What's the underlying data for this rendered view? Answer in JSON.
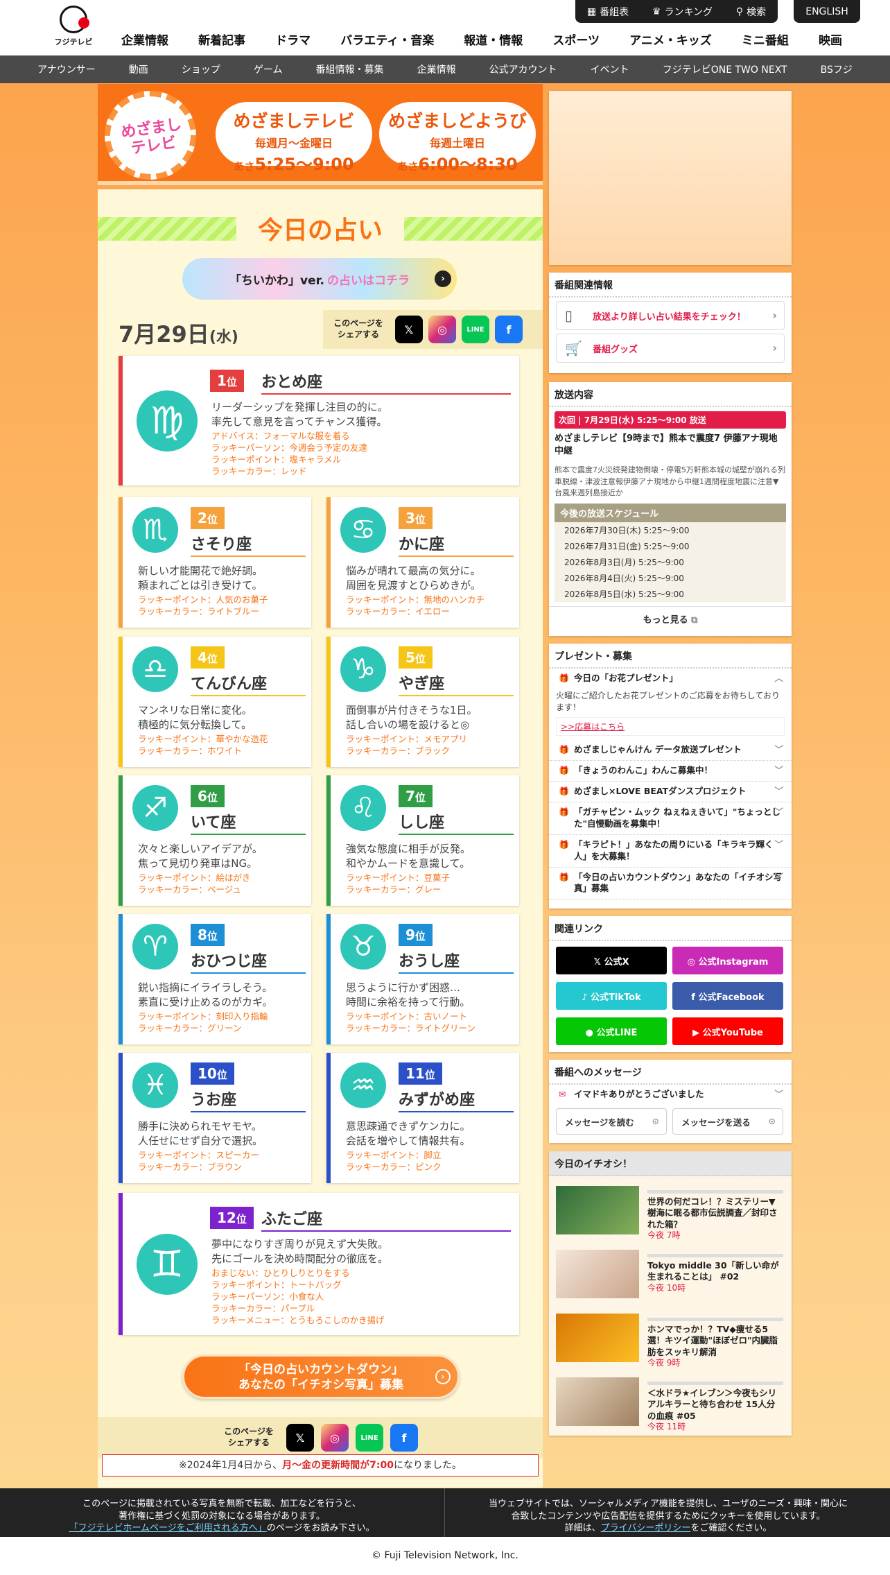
{
  "header": {
    "logo_text": "フジテレビ",
    "toolbar": [
      {
        "label": "番組表",
        "icon": "grid-icon"
      },
      {
        "label": "ランキング",
        "icon": "crown-icon"
      },
      {
        "label": "検索",
        "icon": "search-icon"
      }
    ],
    "english": "ENGLISH",
    "main_nav": [
      "企業情報",
      "新着記事",
      "ドラマ",
      "バラエティ・音楽",
      "報道・情報",
      "スポーツ",
      "アニメ・キッズ",
      "ミニ番組",
      "映画"
    ],
    "sub_nav": [
      "アナウンサー",
      "動画",
      "ショップ",
      "ゲーム",
      "番組情報・募集",
      "企業情報",
      "公式アカウント",
      "イベント",
      "フジテレビONE TWO NEXT",
      "BSフジ"
    ]
  },
  "banner": {
    "logo": "めざまし テレビ",
    "show1": {
      "name": "めざましテレビ",
      "days": "毎週月〜金曜日",
      "time_prefix": "あさ",
      "time": "5:25〜9:00"
    },
    "show2": {
      "name": "めざましどようび",
      "days": "毎週土曜日",
      "time_prefix": "あさ",
      "time": "6:00〜8:30"
    }
  },
  "page": {
    "title": "今日の占い",
    "chiikawa_a": "「ちいかわ」ver.",
    "chiikawa_b": "の占いはコチラ",
    "date_md": "7月29日",
    "date_w": "(水)",
    "share_label": "このページを シェアする",
    "share_x": "𝕏",
    "share_line": "LINE",
    "share_fb": "f",
    "countdown_line1": "「今日の占いカウントダウン」",
    "countdown_line2": "あなたの「イチオシ写真」募集",
    "notice_a": "※2024年1月4日から、",
    "notice_b": "月〜金の更新時間が7:00",
    "notice_c": "になりました。"
  },
  "ranks": [
    {
      "rank": "1",
      "unit": "位",
      "sign": "おとめ座",
      "glyph": "♍",
      "color": "#e53e3e",
      "desc1": "リーダーシップを発揮し注目の的に。",
      "desc2": "率先して意見を言ってチャンス獲得。",
      "luck": [
        "アドバイス：フォーマルな服を着る",
        "ラッキーパーソン：今週会う予定の友達",
        "ラッキーポイント：塩キャラメル",
        "ラッキーカラー：レッド"
      ]
    },
    {
      "rank": "2",
      "unit": "位",
      "sign": "さそり座",
      "glyph": "♏",
      "color": "#f6a23c",
      "desc1": "新しい才能開花で絶好調。",
      "desc2": "頼まれごとは引き受けて。",
      "luck": [
        "ラッキーポイント：人気のお菓子",
        "ラッキーカラー：ライトブルー"
      ]
    },
    {
      "rank": "3",
      "unit": "位",
      "sign": "かに座",
      "glyph": "♋",
      "color": "#f6a23c",
      "desc1": "悩みが晴れて最高の気分に。",
      "desc2": "周囲を見渡すとひらめきが。",
      "luck": [
        "ラッキーポイント：無地のハンカチ",
        "ラッキーカラー：イエロー"
      ]
    },
    {
      "rank": "4",
      "unit": "位",
      "sign": "てんびん座",
      "glyph": "♎",
      "color": "#f5c518",
      "desc1": "マンネリな日常に変化。",
      "desc2": "積極的に気分転換して。",
      "luck": [
        "ラッキーポイント：華やかな造花",
        "ラッキーカラー：ホワイト"
      ]
    },
    {
      "rank": "5",
      "unit": "位",
      "sign": "やぎ座",
      "glyph": "♑",
      "color": "#f5c518",
      "desc1": "面倒事が片付きそうな1日。",
      "desc2": "話し合いの場を設けると◎",
      "luck": [
        "ラッキーポイント：メモアプリ",
        "ラッキーカラー：ブラック"
      ]
    },
    {
      "rank": "6",
      "unit": "位",
      "sign": "いて座",
      "glyph": "♐",
      "color": "#2f9e44",
      "desc1": "次々と楽しいアイデアが。",
      "desc2": "焦って見切り発車はNG。",
      "luck": [
        "ラッキーポイント：絵はがき",
        "ラッキーカラー：ベージュ"
      ]
    },
    {
      "rank": "7",
      "unit": "位",
      "sign": "しし座",
      "glyph": "♌",
      "color": "#2f9e44",
      "desc1": "強気な態度に相手が反発。",
      "desc2": "和やかムードを意識して。",
      "luck": [
        "ラッキーポイント：豆菓子",
        "ラッキーカラー：グレー"
      ]
    },
    {
      "rank": "8",
      "unit": "位",
      "sign": "おひつじ座",
      "glyph": "♈",
      "color": "#1c8fd6",
      "desc1": "鋭い指摘にイライラしそう。",
      "desc2": "素直に受け止めるのがカギ。",
      "luck": [
        "ラッキーポイント：刻印入り指輪",
        "ラッキーカラー：グリーン"
      ]
    },
    {
      "rank": "9",
      "unit": "位",
      "sign": "おうし座",
      "glyph": "♉",
      "color": "#1c8fd6",
      "desc1": "思うように行かず困惑…",
      "desc2": "時間に余裕を持って行動。",
      "luck": [
        "ラッキーポイント：古いノート",
        "ラッキーカラー：ライトグリーン"
      ]
    },
    {
      "rank": "10",
      "unit": "位",
      "sign": "うお座",
      "glyph": "♓",
      "color": "#2b50c8",
      "desc1": "勝手に決められモヤモヤ。",
      "desc2": "人任せにせず自分で選択。",
      "luck": [
        "ラッキーポイント：スピーカー",
        "ラッキーカラー：ブラウン"
      ]
    },
    {
      "rank": "11",
      "unit": "位",
      "sign": "みずがめ座",
      "glyph": "♒",
      "color": "#2b50c8",
      "desc1": "意思疎通できずケンカに。",
      "desc2": "会話を増やして情報共有。",
      "luck": [
        "ラッキーポイント：脚立",
        "ラッキーカラー：ピンク"
      ]
    },
    {
      "rank": "12",
      "unit": "位",
      "sign": "ふたご座",
      "glyph": "♊",
      "color": "#7e22ce",
      "desc1": "夢中になりすぎ周りが見えず大失敗。",
      "desc2": "先にゴールを決め時間配分の徹底を。",
      "luck": [
        "おまじない：ひとりしりとりをする",
        "ラッキーポイント：トートバッグ",
        "ラッキーパーソン：小食な人",
        "ラッキーカラー：パープル",
        "ラッキーメニュー：とうもろこしのかき揚げ"
      ]
    }
  ],
  "sidebar": {
    "related": {
      "title": "番組関連情報",
      "items": [
        "放送より詳しい占い結果をチェック！",
        "番組グッズ"
      ]
    },
    "broadcast": {
      "title": "放送内容",
      "next": "次回 | 7月29日(水) 5:25〜9:00 放送",
      "headline": "めざましテレビ【9時まで】熊本で震度7 伊藤アナ現地中継",
      "summary": "熊本で震度7火災続発建物倒壊・停電5万軒熊本城の城壁が崩れる列車脱線・津波注意報伊藤アナ現地から中継1週間程度地震に注意▼台風来週列島接近か",
      "schedule_title": "今後の放送スケジュール",
      "schedule": [
        "2026年7月30日(木) 5:25〜9:00",
        "2026年7月31日(金) 5:25〜9:00",
        "2026年8月3日(月) 5:25〜9:00",
        "2026年8月4日(火) 5:25〜9:00",
        "2026年8月5日(水) 5:25〜9:00"
      ],
      "more": "もっと見る"
    },
    "present": {
      "title": "プレゼント・募集",
      "open_title": "今日の「お花プレゼント」",
      "open_text": "火曜にご紹介したお花プレゼントのご応募をお待ちしております！",
      "apply": ">>応募はこちら",
      "items": [
        "めざましじゃんけん データ放送プレゼント",
        "「きょうのわんこ」わんこ募集中！",
        "めざまし×LOVE BEATダンスプロジェクト",
        "「ガチャピン・ムック ねぇねぇきいて」\"ちょっとした\"自慢動画を募集中！",
        "「キラピト！」あなたの周りにいる「キラキラ輝く人」を大募集！",
        "「今日の占いカウントダウン」あなたの「イチオシ写真」募集"
      ]
    },
    "links": {
      "title": "関連リンク",
      "buttons": [
        {
          "label": "𝕏 公式X",
          "color": "#000000"
        },
        {
          "label": "◎ 公式Instagram",
          "color": "#c92bb7"
        },
        {
          "label": "♪ 公式TikTok",
          "color": "#24c8d0"
        },
        {
          "label": "f 公式Facebook",
          "color": "#3b5bab"
        },
        {
          "label": "● 公式LINE",
          "color": "#06c706"
        },
        {
          "label": "▶ 公式YouTube",
          "color": "#ff0000"
        }
      ]
    },
    "message": {
      "title": "番組へのメッセージ",
      "open": "イマドキありがとうございました",
      "read": "メッセージを読む",
      "send": "メッセージを送る"
    },
    "picks": {
      "title": "今日のイチオシ！",
      "items": [
        {
          "title": "世界の何だコレ！？ミステリー▼樹海に眠る都市伝説調査／封印された箱？",
          "time": "今夜 7時"
        },
        {
          "title": "Tokyo middle 30「新しい命が生まれることは」 #02",
          "time": "今夜 10時"
        },
        {
          "title": "ホンマでっか！？TV◆痩せる5選！キツイ運動\"ほぼゼロ\"内臓脂肪をスッキリ解消",
          "time": "今夜 9時"
        },
        {
          "title": "＜水ドラ★イレブン＞今夜もシリアルキラーと待ち合わせ 15人分の血痕 #05",
          "time": "今夜 11時"
        }
      ]
    }
  },
  "footer": {
    "left1": "このページに掲載されている写真を無断で転載、加工などを行うと、",
    "left2": "著作権に基づく処罰の対象になる場合があります。",
    "left_link": "「フジテレビホームページをご利用される方へ」",
    "left3": "のページをお読み下さい。",
    "right1": "当ウェブサイトでは、ソーシャルメディア機能を提供し、ユーザのニーズ・興味・関心に",
    "right2": "合致したコンテンツや広告配信を提供するためにクッキーを使用しています。",
    "right3a": "詳細は、",
    "right_link": "プライバシーポリシー",
    "right3b": "をご確認ください。",
    "copyright": "© Fuji Television Network, Inc."
  }
}
